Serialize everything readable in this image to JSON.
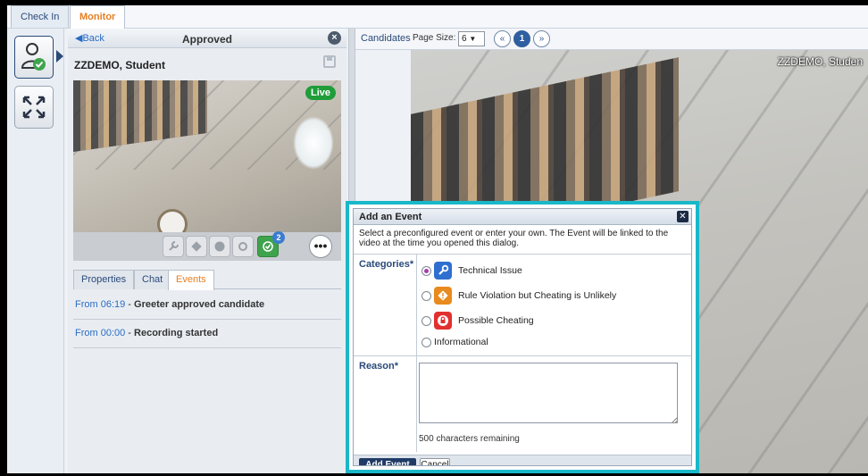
{
  "tabs": [
    {
      "label": "Check In"
    },
    {
      "label": "Monitor"
    }
  ],
  "panel": {
    "back_label": "Back",
    "status": "Approved",
    "candidate_name": "ZZDEMO, Student",
    "live_label": "Live",
    "notification_count": "2",
    "more_label": "•••",
    "subtabs": [
      {
        "label": "Properties"
      },
      {
        "label": "Chat"
      },
      {
        "label": "Events"
      }
    ],
    "events": [
      {
        "time": "From 06:19",
        "sep": " - ",
        "text": "Greeter approved candidate"
      },
      {
        "time": "From 00:00",
        "sep": " - ",
        "text": "Recording started"
      }
    ]
  },
  "candidates": {
    "title": "Candidates",
    "page_size_label": "Page Size:",
    "page_size_value": "6",
    "prev_label": "«",
    "current_page": "1",
    "next_label": "»",
    "video_name": "ZZDEMO, Studen"
  },
  "dialog": {
    "title": "Add an Event",
    "instructions": "Select a preconfigured event or enter your own. The Event will be linked to the video at the time you opened this dialog.",
    "categories_label": "Categories*",
    "options": [
      {
        "label": "Technical Issue",
        "icon": "wrench-icon",
        "selected": true
      },
      {
        "label": "Rule Violation but Cheating is Unlikely",
        "icon": "warning-icon",
        "selected": false
      },
      {
        "label": "Possible Cheating",
        "icon": "lock-icon",
        "selected": false
      },
      {
        "label": "Informational",
        "icon": "",
        "selected": false
      }
    ],
    "reason_label": "Reason*",
    "reason_value": "",
    "remaining": "500 characters remaining",
    "add_button": "Add Event",
    "cancel_button": "Cancel"
  },
  "colors": {
    "accent": "#19b8c9",
    "active_tab": "#e67e22",
    "live": "#1f9d3a",
    "primary_button": "#1f3b66"
  }
}
